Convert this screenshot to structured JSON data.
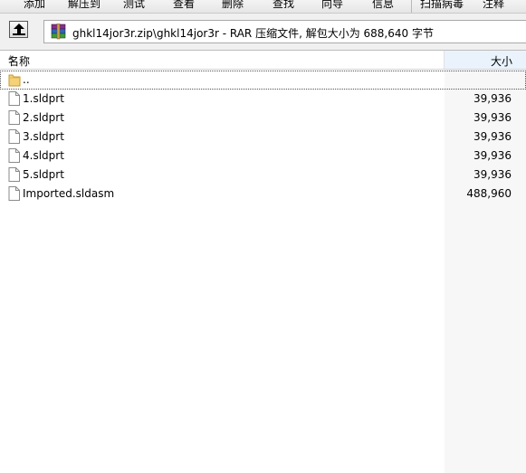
{
  "toolbar": {
    "buttons": [
      "添加",
      "解压到",
      "测试",
      "查看",
      "删除",
      "查找",
      "向导",
      "信息",
      "扫描病毒",
      "注释"
    ]
  },
  "address": {
    "path": "ghkl14jor3r.zip\\ghkl14jor3r - RAR 压缩文件, 解包大小为 688,640 字节"
  },
  "columns": {
    "name": "名称",
    "size": "大小"
  },
  "files": [
    {
      "name": "..",
      "size": "",
      "icon": "folder-icon"
    },
    {
      "name": "1.sldprt",
      "size": "39,936",
      "icon": "file-icon"
    },
    {
      "name": "2.sldprt",
      "size": "39,936",
      "icon": "file-icon"
    },
    {
      "name": "3.sldprt",
      "size": "39,936",
      "icon": "file-icon"
    },
    {
      "name": "4.sldprt",
      "size": "39,936",
      "icon": "file-icon"
    },
    {
      "name": "5.sldprt",
      "size": "39,936",
      "icon": "file-icon"
    },
    {
      "name": "Imported.sldasm",
      "size": "488,960",
      "icon": "file-icon"
    }
  ],
  "colors": {
    "size_column_bg": "#f7f7f7",
    "header_size_bg": "#eaf3fb"
  }
}
